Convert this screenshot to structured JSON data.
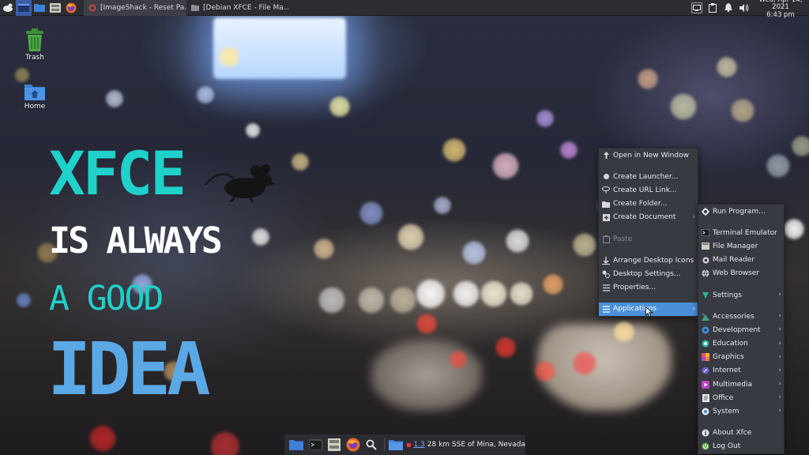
{
  "top_panel": {
    "launchers": [
      {
        "icon": "xfce-mouse-icon"
      },
      {
        "icon": "window-icon"
      },
      {
        "icon": "desktop-icon"
      },
      {
        "icon": "file-manager-icon"
      },
      {
        "icon": "firefox-icon"
      }
    ],
    "tasks": [
      {
        "label": "[ImageShack - Reset Pa...",
        "icon": "firefox-icon",
        "active": true
      },
      {
        "label": "[Debian XFCE - File Ma...",
        "icon": "folder-icon",
        "active": false
      }
    ],
    "clock": {
      "date": "Wed, Apr 14, 2021",
      "time": "6:43 pm"
    }
  },
  "desktop": {
    "icons": [
      {
        "label": "Trash",
        "icon": "trash-icon"
      },
      {
        "label": "Home",
        "icon": "home-folder-icon"
      }
    ]
  },
  "wallpaper": {
    "line1": "XFCE",
    "line2": "IS ALWAYS",
    "line3": "A GOOD",
    "line4": "IDEA",
    "colors": {
      "teal": "#1fd1c9",
      "white": "#ffffff",
      "blue": "#5aa9e6"
    }
  },
  "context_menu": {
    "items": [
      {
        "label": "Open in New Window",
        "icon": "open-window-icon"
      },
      {
        "label": "Create Launcher...",
        "icon": "launcher-icon"
      },
      {
        "label": "Create URL Link...",
        "icon": "link-icon"
      },
      {
        "label": "Create Folder...",
        "icon": "new-folder-icon"
      },
      {
        "label": "Create Document",
        "icon": "new-document-icon",
        "submenu": true
      },
      {
        "label": "Paste",
        "icon": "paste-icon",
        "disabled": true
      },
      {
        "label": "Arrange Desktop Icons",
        "icon": "arrange-icon"
      },
      {
        "label": "Desktop Settings...",
        "icon": "desktop-settings-icon"
      },
      {
        "label": "Properties...",
        "icon": "properties-icon"
      },
      {
        "label": "Applications",
        "icon": "applications-icon",
        "submenu": true,
        "highlighted": true
      }
    ]
  },
  "applications_menu": {
    "items": [
      {
        "label": "Run Program...",
        "icon": "run-icon"
      },
      {
        "label": "Terminal Emulator",
        "icon": "terminal-icon"
      },
      {
        "label": "File Manager",
        "icon": "file-manager-icon"
      },
      {
        "label": "Mail Reader",
        "icon": "mail-icon"
      },
      {
        "label": "Web Browser",
        "icon": "web-browser-icon"
      },
      {
        "label": "Settings",
        "icon": "settings-icon",
        "submenu": true
      },
      {
        "label": "Accessories",
        "icon": "accessories-icon",
        "submenu": true
      },
      {
        "label": "Development",
        "icon": "development-icon",
        "submenu": true
      },
      {
        "label": "Education",
        "icon": "education-icon",
        "submenu": true
      },
      {
        "label": "Graphics",
        "icon": "graphics-icon",
        "submenu": true
      },
      {
        "label": "Internet",
        "icon": "internet-icon",
        "submenu": true
      },
      {
        "label": "Multimedia",
        "icon": "multimedia-icon",
        "submenu": true
      },
      {
        "label": "Office",
        "icon": "office-icon",
        "submenu": true
      },
      {
        "label": "System",
        "icon": "system-icon",
        "submenu": true
      },
      {
        "label": "About Xfce",
        "icon": "about-icon"
      },
      {
        "label": "Log Out",
        "icon": "logout-icon"
      }
    ]
  },
  "dock": {
    "items": [
      {
        "icon": "show-desktop-icon"
      },
      {
        "icon": "terminal-icon"
      },
      {
        "icon": "file-manager-icon"
      },
      {
        "icon": "firefox-icon"
      },
      {
        "icon": "search-icon"
      },
      {
        "icon": "folder-icon"
      }
    ],
    "weather": {
      "value": "1.3",
      "location": "28 km SSE of Mina, Nevada"
    }
  },
  "accent_color": "#4a90d9"
}
